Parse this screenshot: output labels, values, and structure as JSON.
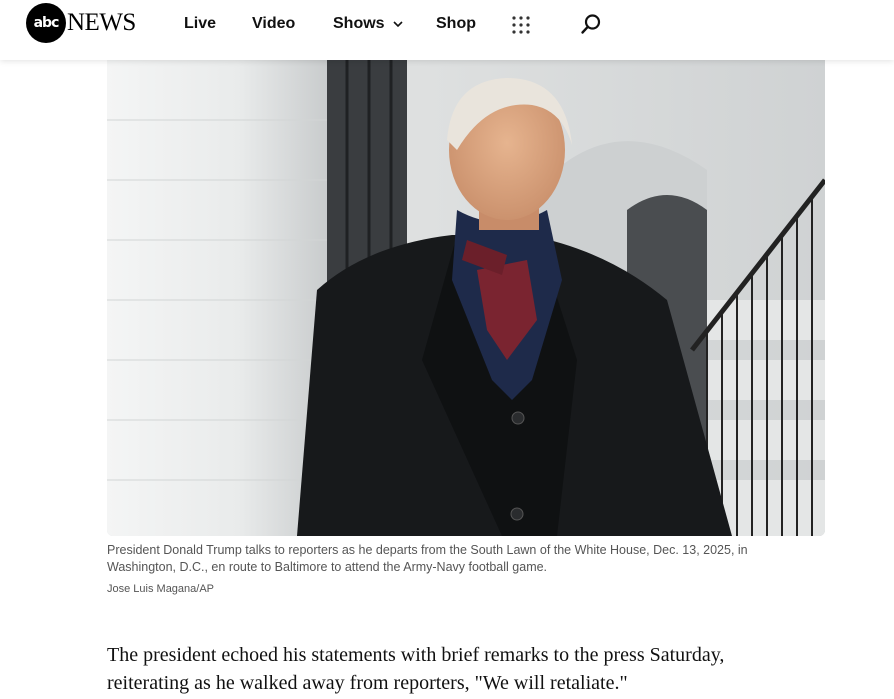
{
  "header": {
    "logo": {
      "abc": "abc",
      "news": "NEWS"
    },
    "nav": [
      {
        "label": "Live"
      },
      {
        "label": "Video"
      },
      {
        "label": "Shows"
      },
      {
        "label": "Shop"
      }
    ],
    "icons": [
      "chevron-down-icon",
      "apps-grid-icon",
      "search-icon"
    ]
  },
  "article": {
    "image": {
      "subject": "photo",
      "caption": "President Donald Trump talks to reporters as he departs from the South Lawn of the White House, Dec. 13, 2025, in Washington, D.C., en route to Baltimore to attend the Army-Navy football game.",
      "credit": "Jose Luis Magana/AP"
    },
    "paragraph": "The president echoed his statements with brief remarks to the press Saturday, reiterating as he walked away from reporters, \"We will retaliate.\""
  },
  "colors": {
    "header_bg": "#ffffff",
    "text": "#111111",
    "caption": "#555555"
  }
}
